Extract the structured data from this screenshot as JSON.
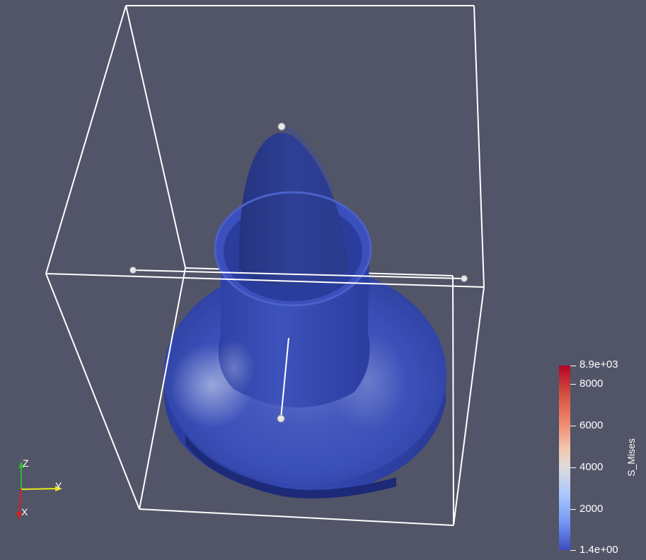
{
  "viewport": {
    "background": "#525468"
  },
  "model": {
    "surface_color": "#3a4fb8",
    "highlight_color": "#c0c8e0",
    "bounding_box_color": "#ffffff"
  },
  "colorbar": {
    "title": "S_Mises",
    "colormap": "coolwarm",
    "labels": {
      "max": "8.9e+03",
      "t8000": "8000",
      "t6000": "6000",
      "t4000": "4000",
      "t2000": "2000",
      "min": "1.4e+00"
    }
  },
  "orientation_axes": {
    "z_label": "Z",
    "y_label": "Y",
    "x_label": "X",
    "z_color": "#2fb82f",
    "y_color": "#e6e61a",
    "x_color": "#d42020"
  }
}
